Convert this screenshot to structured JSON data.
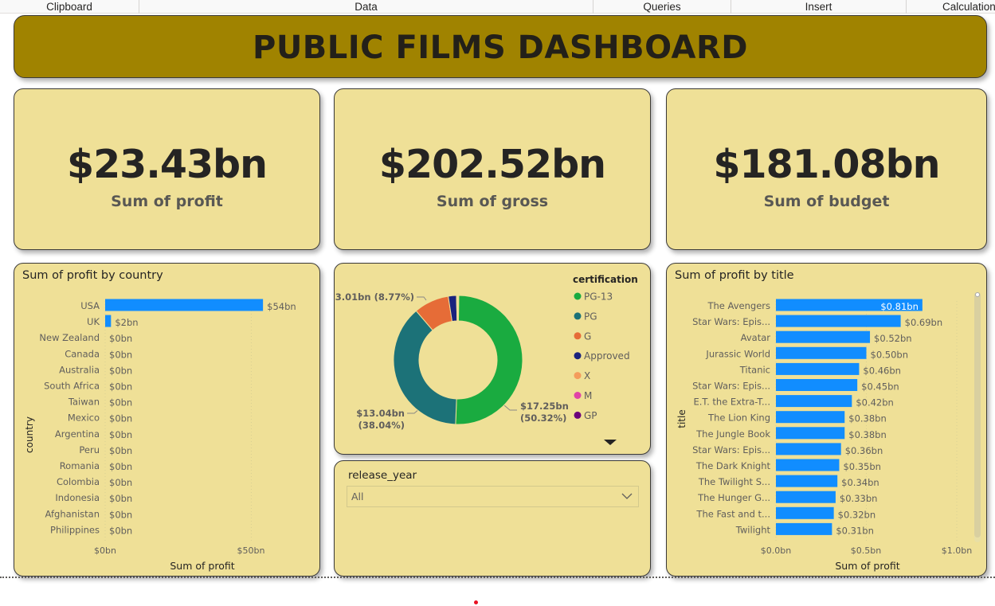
{
  "ribbon": {
    "groups": [
      "Clipboard",
      "Data",
      "Queries",
      "Insert",
      "Calculation"
    ]
  },
  "dashboard_title": "PUBLIC FILMS DASHBOARD",
  "kpis": {
    "profit": {
      "value": "$23.43bn",
      "label": "Sum of profit"
    },
    "gross": {
      "value": "$202.52bn",
      "label": "Sum of gross"
    },
    "budget": {
      "value": "$181.08bn",
      "label": "Sum of budget"
    }
  },
  "colors": {
    "card_bg": "#efe097",
    "title_bg": "#a08300",
    "bar": "#118dff",
    "pg13": "#1aab40",
    "pg": "#1c7278",
    "g": "#e66c37",
    "approved": "#1a237e",
    "x": "#f49c5c",
    "m": "#e044a7",
    "gp": "#6b007b"
  },
  "country_chart": {
    "title": "Sum of profit by country",
    "ylabel": "country",
    "xlabel": "Sum of profit",
    "x_ticks": [
      "$0bn",
      "$50bn"
    ]
  },
  "certification_chart": {
    "legend_title": "certification",
    "labels": {
      "g": "$3.01bn (8.77%)",
      "pg13_value": "$17.25bn",
      "pg13_pct": "(50.32%)",
      "pg_value": "$13.04bn",
      "pg_pct": "(38.04%)"
    }
  },
  "title_chart": {
    "title": "Sum of profit by title",
    "ylabel": "title",
    "xlabel": "Sum of profit",
    "x_ticks": [
      "$0.0bn",
      "$0.5bn",
      "$1.0bn"
    ]
  },
  "slicer": {
    "title": "release_year",
    "value": "All"
  },
  "chart_data": [
    {
      "type": "bar",
      "orientation": "horizontal",
      "title": "Sum of profit by country",
      "xlabel": "Sum of profit",
      "ylabel": "country",
      "categories": [
        "USA",
        "UK",
        "New Zealand",
        "Canada",
        "Australia",
        "South Africa",
        "Taiwan",
        "Mexico",
        "Argentina",
        "Peru",
        "Romania",
        "Colombia",
        "Indonesia",
        "Afghanistan",
        "Philippines"
      ],
      "values": [
        54,
        2,
        0,
        0,
        0,
        0,
        0,
        0,
        0,
        0,
        0,
        0,
        0,
        0,
        0
      ],
      "data_labels": [
        "$54bn",
        "$2bn",
        "$0bn",
        "$0bn",
        "$0bn",
        "$0bn",
        "$0bn",
        "$0bn",
        "$0bn",
        "$0bn",
        "$0bn",
        "$0bn",
        "$0bn",
        "$0bn",
        "$0bn"
      ],
      "xlim": [
        0,
        68
      ],
      "x_ticks": [
        "$0bn",
        "$50bn"
      ]
    },
    {
      "type": "pie",
      "variant": "donut",
      "legend_title": "certification",
      "legend_position": "right",
      "categories": [
        "PG-13",
        "PG",
        "G",
        "Approved",
        "X",
        "M",
        "GP"
      ],
      "values": [
        17.25,
        13.04,
        3.01,
        0.7,
        0.08,
        0.06,
        0.05
      ],
      "percent": [
        50.32,
        38.04,
        8.77,
        2.04,
        0.3,
        0.2,
        0.15
      ]
    },
    {
      "type": "bar",
      "orientation": "horizontal",
      "title": "Sum of profit by title",
      "xlabel": "Sum of profit",
      "ylabel": "title",
      "categories": [
        "The Avengers",
        "Star Wars: Epis...",
        "Avatar",
        "Jurassic World",
        "Titanic",
        "Star Wars: Epis...",
        "E.T. the Extra-T...",
        "The Lion King",
        "The Jungle Book",
        "Star Wars: Epis...",
        "The Dark Knight",
        "The Twilight S...",
        "The Hunger G...",
        "The Fast and t...",
        "Twilight"
      ],
      "values": [
        0.81,
        0.69,
        0.52,
        0.5,
        0.46,
        0.45,
        0.42,
        0.38,
        0.38,
        0.36,
        0.35,
        0.34,
        0.33,
        0.32,
        0.31
      ],
      "data_labels": [
        "$0.81bn",
        "$0.69bn",
        "$0.52bn",
        "$0.50bn",
        "$0.46bn",
        "$0.45bn",
        "$0.42bn",
        "$0.38bn",
        "$0.38bn",
        "$0.36bn",
        "$0.35bn",
        "$0.34bn",
        "$0.33bn",
        "$0.32bn",
        "$0.31bn"
      ],
      "xlim": [
        0,
        1.0
      ],
      "x_ticks": [
        "$0.0bn",
        "$0.5bn",
        "$1.0bn"
      ]
    }
  ]
}
